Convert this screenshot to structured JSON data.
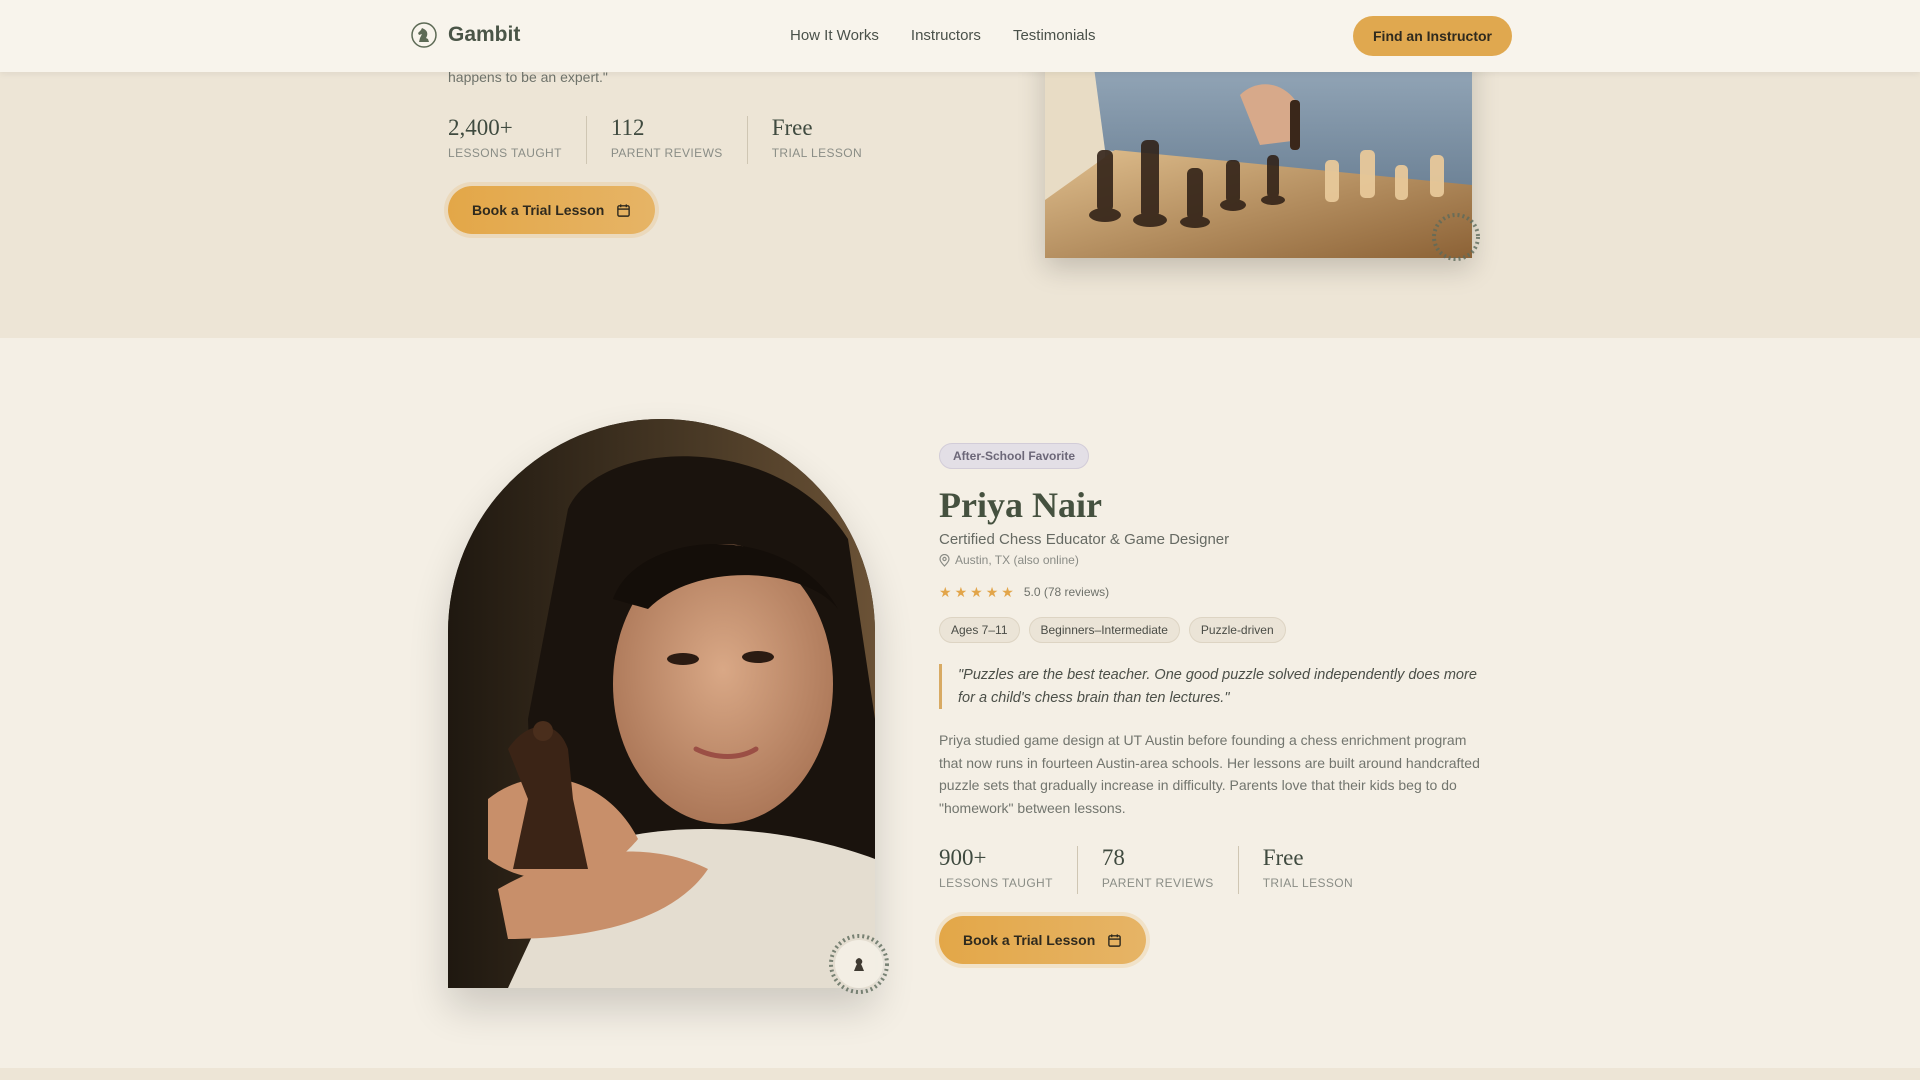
{
  "brand": {
    "name": "Gambit"
  },
  "nav": {
    "links": [
      "How It Works",
      "Instructors",
      "Testimonials"
    ],
    "cta": "Find an Instructor"
  },
  "instructor_prev": {
    "quote_tail": "happens to be an expert.\"",
    "stats": [
      {
        "value": "2,400+",
        "label": "LESSONS TAUGHT"
      },
      {
        "value": "112",
        "label": "PARENT REVIEWS"
      },
      {
        "value": "Free",
        "label": "TRIAL LESSON"
      }
    ],
    "book_label": "Book a Trial Lesson"
  },
  "instructor": {
    "badge": "After-School Favorite",
    "name": "Priya Nair",
    "title": "Certified Chess Educator & Game Designer",
    "location": "Austin, TX (also online)",
    "rating_stars": 5,
    "rating_text": "5.0 (78 reviews)",
    "tags": [
      "Ages 7–11",
      "Beginners–Intermediate",
      "Puzzle-driven"
    ],
    "quote": "\"Puzzles are the best teacher. One good puzzle solved independently does more for a child's chess brain than ten lectures.\"",
    "bio": "Priya studied game design at UT Austin before founding a chess enrichment program that now runs in fourteen Austin-area schools. Her lessons are built around handcrafted puzzle sets that gradually increase in difficulty. Parents love that their kids beg to do \"homework\" between lessons.",
    "stats": [
      {
        "value": "900+",
        "label": "LESSONS TAUGHT"
      },
      {
        "value": "78",
        "label": "PARENT REVIEWS"
      },
      {
        "value": "Free",
        "label": "TRIAL LESSON"
      }
    ],
    "book_label": "Book a Trial Lesson"
  },
  "colors": {
    "accent": "#e0a84f",
    "heading": "#45513f",
    "section_alt": "#ede5d6",
    "section_main": "#f4efe5",
    "badge_bg": "#e3dfe6"
  },
  "icons": [
    "knight-logo-icon",
    "calendar-icon",
    "map-pin-icon",
    "star-icon",
    "pawn-icon"
  ]
}
